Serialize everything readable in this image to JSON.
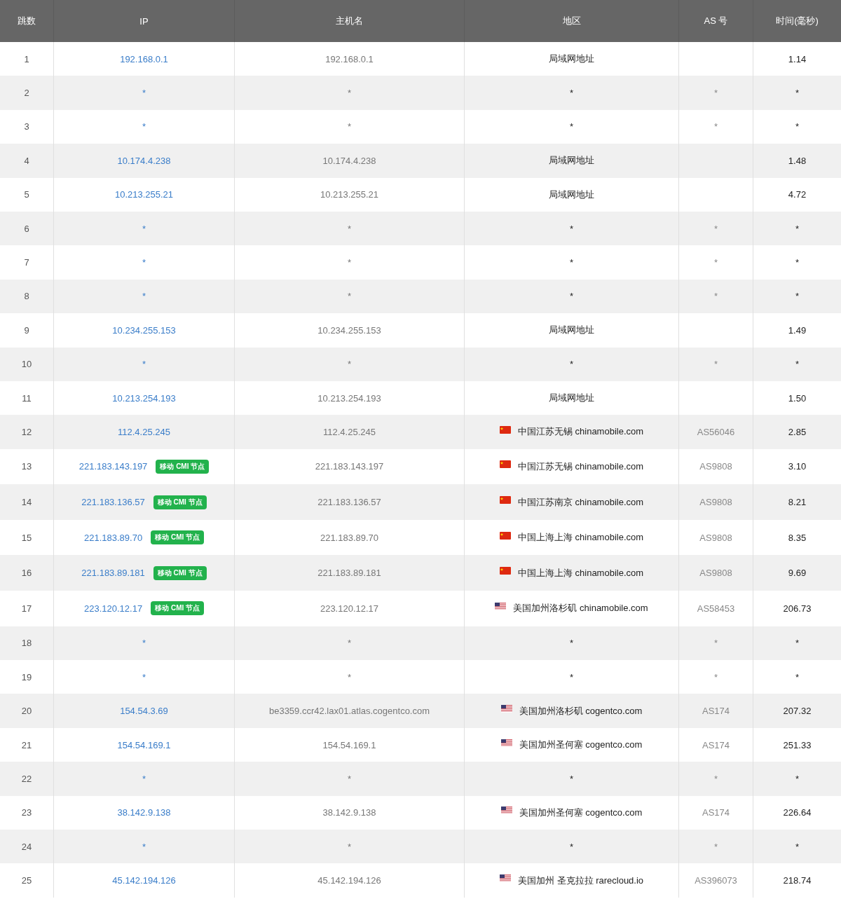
{
  "table": {
    "columns": [
      "跳数",
      "IP",
      "主机名",
      "地区",
      "AS 号",
      "时间(毫秒)"
    ],
    "rows": [
      {
        "hop": "1",
        "ip": "192.168.0.1",
        "host": "192.168.0.1",
        "region": "局域网地址",
        "as": "",
        "time": "1.14"
      },
      {
        "hop": "2",
        "ip": "*",
        "host": "*",
        "region": "*",
        "as": "*",
        "time": "*"
      },
      {
        "hop": "3",
        "ip": "*",
        "host": "*",
        "region": "*",
        "as": "*",
        "time": "*"
      },
      {
        "hop": "4",
        "ip": "10.174.4.238",
        "host": "10.174.4.238",
        "region": "局域网地址",
        "as": "",
        "time": "1.48"
      },
      {
        "hop": "5",
        "ip": "10.213.255.21",
        "host": "10.213.255.21",
        "region": "局域网地址",
        "as": "",
        "time": "4.72"
      },
      {
        "hop": "6",
        "ip": "*",
        "host": "*",
        "region": "*",
        "as": "*",
        "time": "*"
      },
      {
        "hop": "7",
        "ip": "*",
        "host": "*",
        "region": "*",
        "as": "*",
        "time": "*"
      },
      {
        "hop": "8",
        "ip": "*",
        "host": "*",
        "region": "*",
        "as": "*",
        "time": "*"
      },
      {
        "hop": "9",
        "ip": "10.234.255.153",
        "host": "10.234.255.153",
        "region": "局域网地址",
        "as": "",
        "time": "1.49"
      },
      {
        "hop": "10",
        "ip": "*",
        "host": "*",
        "region": "*",
        "as": "*",
        "time": "*"
      },
      {
        "hop": "11",
        "ip": "10.213.254.193",
        "host": "10.213.254.193",
        "region": "局域网地址",
        "as": "",
        "time": "1.50"
      },
      {
        "hop": "12",
        "ip": "112.4.25.245",
        "host": "112.4.25.245",
        "kind": "cn",
        "region": "中国江苏无锡 chinamobile.com",
        "as": "AS56046",
        "time": "2.85"
      },
      {
        "hop": "13",
        "ip": "221.183.143.197",
        "badge": "移动 CMI 节点",
        "host": "221.183.143.197",
        "kind": "cn",
        "region": "中国江苏无锡 chinamobile.com",
        "as": "AS9808",
        "time": "3.10"
      },
      {
        "hop": "14",
        "ip": "221.183.136.57",
        "badge": "移动 CMI 节点",
        "host": "221.183.136.57",
        "kind": "cn",
        "region": "中国江苏南京 chinamobile.com",
        "as": "AS9808",
        "time": "8.21"
      },
      {
        "hop": "15",
        "ip": "221.183.89.70",
        "badge": "移动 CMI 节点",
        "host": "221.183.89.70",
        "kind": "cn",
        "region": "中国上海上海 chinamobile.com",
        "as": "AS9808",
        "time": "8.35"
      },
      {
        "hop": "16",
        "ip": "221.183.89.181",
        "badge": "移动 CMI 节点",
        "host": "221.183.89.181",
        "kind": "cn",
        "region": "中国上海上海 chinamobile.com",
        "as": "AS9808",
        "time": "9.69"
      },
      {
        "hop": "17",
        "ip": "223.120.12.17",
        "badge": "移动 CMI 节点",
        "host": "223.120.12.17",
        "kind": "us",
        "region": "美国加州洛杉矶 chinamobile.com",
        "as": "AS58453",
        "time": "206.73"
      },
      {
        "hop": "18",
        "ip": "*",
        "host": "*",
        "region": "*",
        "as": "*",
        "time": "*"
      },
      {
        "hop": "19",
        "ip": "*",
        "host": "*",
        "region": "*",
        "as": "*",
        "time": "*"
      },
      {
        "hop": "20",
        "ip": "154.54.3.69",
        "host": "be3359.ccr42.lax01.atlas.cogentco.com",
        "kind": "us",
        "region": "美国加州洛杉矶 cogentco.com",
        "as": "AS174",
        "time": "207.32"
      },
      {
        "hop": "21",
        "ip": "154.54.169.1",
        "host": "154.54.169.1",
        "kind": "us",
        "region": "美国加州圣何塞 cogentco.com",
        "as": "AS174",
        "time": "251.33"
      },
      {
        "hop": "22",
        "ip": "*",
        "host": "*",
        "region": "*",
        "as": "*",
        "time": "*"
      },
      {
        "hop": "23",
        "ip": "38.142.9.138",
        "host": "38.142.9.138",
        "kind": "us",
        "region": "美国加州圣何塞 cogentco.com",
        "as": "AS174",
        "time": "226.64"
      },
      {
        "hop": "24",
        "ip": "*",
        "host": "*",
        "region": "*",
        "as": "*",
        "time": "*"
      },
      {
        "hop": "25",
        "ip": "45.142.194.126",
        "host": "45.142.194.126",
        "kind": "us",
        "region": "美国加州 圣克拉拉 rarecloud.io",
        "as": "AS396073",
        "time": "218.74"
      }
    ]
  }
}
